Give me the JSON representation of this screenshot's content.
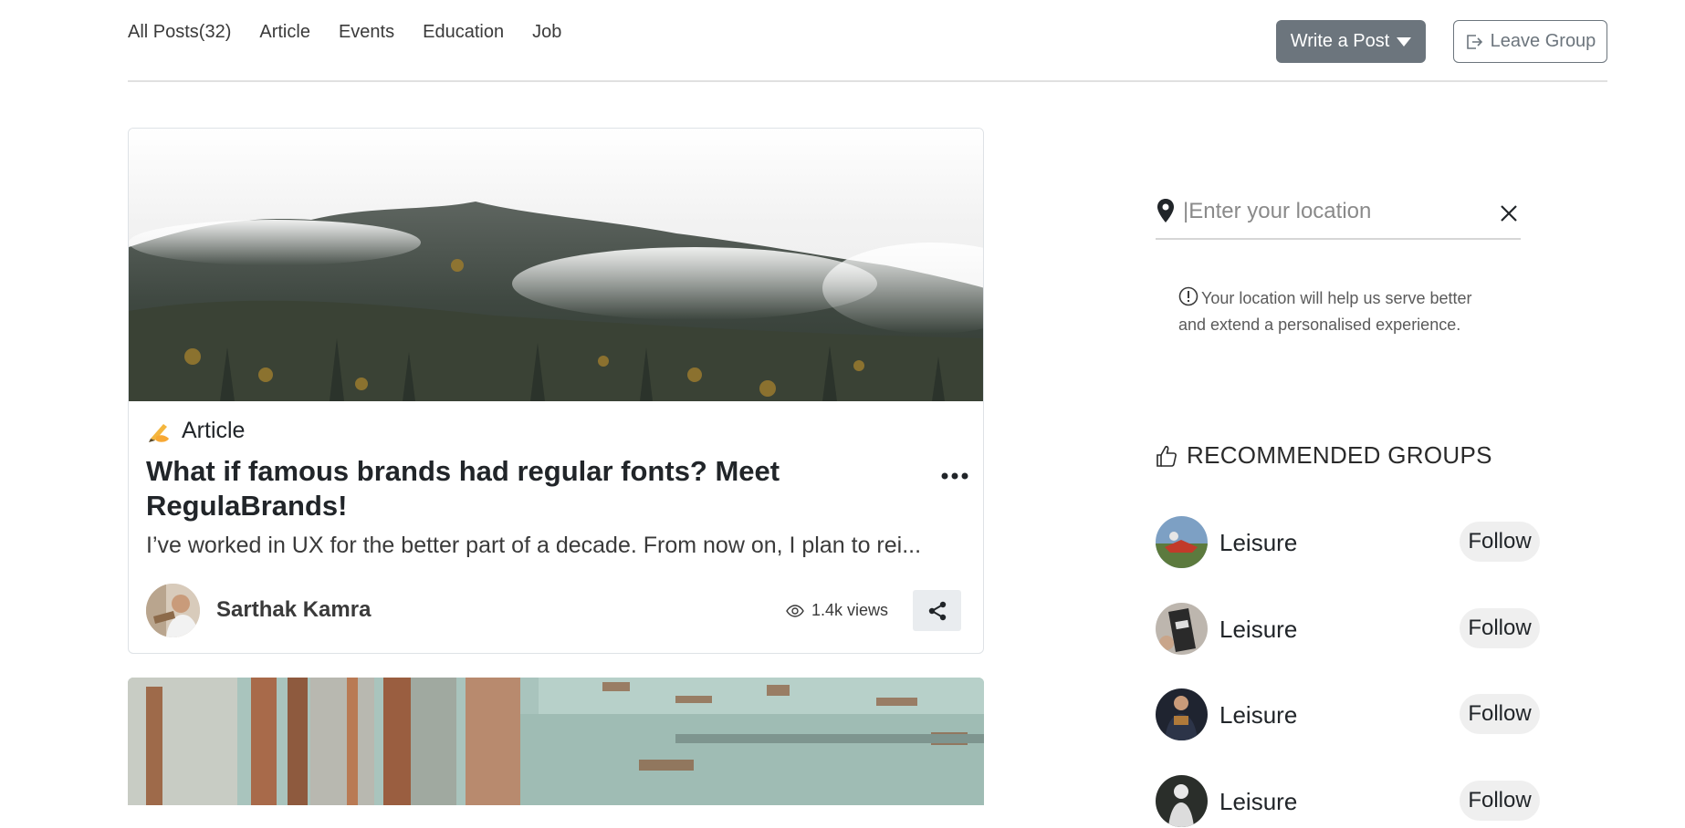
{
  "tabs": [
    {
      "label": "All Posts(32)"
    },
    {
      "label": "Article"
    },
    {
      "label": "Events"
    },
    {
      "label": "Education"
    },
    {
      "label": "Job"
    }
  ],
  "actions": {
    "write_post": "Write a Post",
    "leave_group": "Leave Group"
  },
  "post": {
    "type_label": "Article",
    "type_icon": "writing-hand-icon",
    "title": "What if famous brands had regular fonts? Meet RegulaBrands!",
    "excerpt": "I’ve worked in UX for the better part of a decade. From now on, I plan to rei...",
    "author": "Sarthak Kamra",
    "views": "1.4k views"
  },
  "location": {
    "placeholder": "|Enter your location",
    "note": "Your location will help us serve better and extend a personalised experience."
  },
  "recommended": {
    "title": "RECOMMENDED GROUPS",
    "groups": [
      {
        "name": "Leisure",
        "follow": "Follow"
      },
      {
        "name": "Leisure",
        "follow": "Follow"
      },
      {
        "name": "Leisure",
        "follow": "Follow"
      },
      {
        "name": "Leisure",
        "follow": "Follow"
      }
    ]
  },
  "colors": {
    "primary_button": "#6c757d",
    "border": "#dee2e6",
    "follow_bg": "#efefef"
  }
}
